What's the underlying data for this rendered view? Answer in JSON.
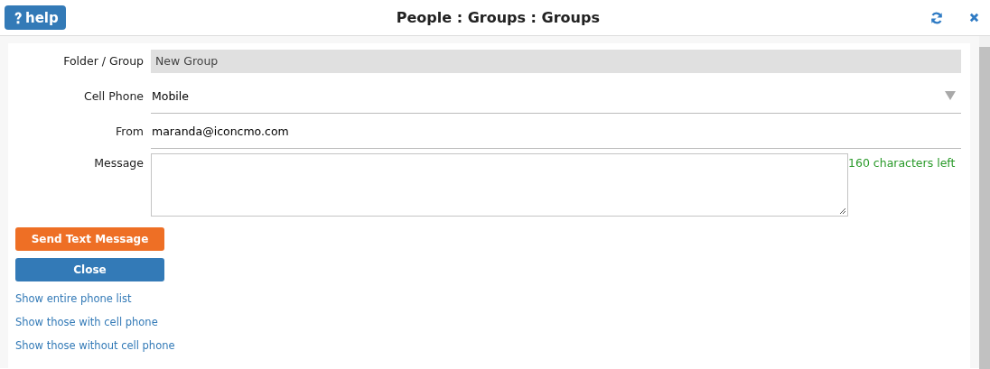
{
  "header": {
    "help_label": "help",
    "title": "People : Groups : Groups"
  },
  "fields": [
    {
      "label": "Folder / Group",
      "kind": "readonly",
      "value": "New Group"
    },
    {
      "label": "Cell Phone",
      "kind": "select",
      "value": "Mobile"
    },
    {
      "label": "From",
      "kind": "text",
      "value": "maranda@iconcmo.com"
    },
    {
      "label": "Message",
      "kind": "textarea",
      "counter": "160 characters left"
    }
  ],
  "buttons": [
    {
      "label": "Send Text Message",
      "color": "#ee6f25"
    },
    {
      "label": "Close",
      "color": "#337ab7"
    }
  ],
  "links": [
    "Show entire phone list",
    "Show those with cell phone",
    "Show those without cell phone"
  ]
}
